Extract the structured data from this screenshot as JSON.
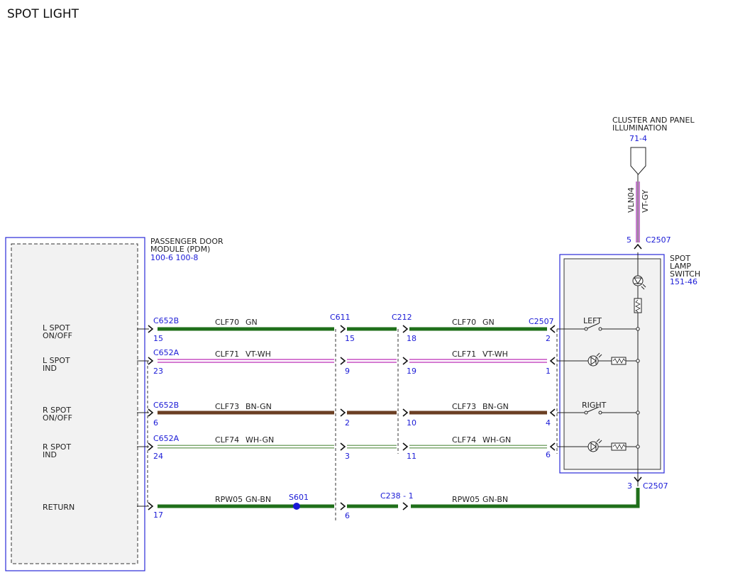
{
  "title": "SPOT LIGHT",
  "colors": {
    "ref_blue": "#1a1ad6",
    "wire_gn": "#1f6f1a",
    "wire_bn_gn": "#6b3f24",
    "wire_vt_wh": "#d57bd2",
    "wire_wh_gn": "#7faa72",
    "wire_vt_gy": "#c77ccf",
    "module_fill": "#f2f2f2"
  },
  "pdm": {
    "name_line1": "PASSENGER DOOR",
    "name_line2": "MODULE (PDM)",
    "ref": "100-6 100-8",
    "pins": [
      {
        "line1": "L SPOT",
        "line2": "ON/OFF"
      },
      {
        "line1": "L SPOT",
        "line2": "IND"
      },
      {
        "line1": "R SPOT",
        "line2": "ON/OFF"
      },
      {
        "line1": "R SPOT",
        "line2": "IND"
      },
      {
        "line1": "RETURN",
        "line2": ""
      }
    ]
  },
  "switch": {
    "name_line1": "SPOT",
    "name_line2": "LAMP",
    "name_line3": "SWITCH",
    "ref": "151-46",
    "left_label": "LEFT",
    "right_label": "RIGHT"
  },
  "illumination": {
    "line1": "CLUSTER AND PANEL",
    "line2": "ILLUMINATION",
    "ref": "71-4",
    "circuit": "VLN04",
    "color": "VT-GY",
    "pin_top": "5",
    "connector_top": "C2507",
    "pin_bottom": "3",
    "connector_bottom": "C2507"
  },
  "inline_connectors": {
    "c611": "C611",
    "c212": "C212",
    "c2507": "C2507",
    "c238": "C238 - 1",
    "splice": "S601"
  },
  "wires": [
    {
      "pdm_connector": "C652B",
      "pdm_pin": "15",
      "circuit": "CLF70",
      "color": "GN",
      "c611_pin": "15",
      "c212_pin": "18",
      "c2507_pin": "2"
    },
    {
      "pdm_connector": "C652A",
      "pdm_pin": "23",
      "circuit": "CLF71",
      "color": "VT-WH",
      "c611_pin": "9",
      "c212_pin": "19",
      "c2507_pin": "1"
    },
    {
      "pdm_connector": "C652B",
      "pdm_pin": "6",
      "circuit": "CLF73",
      "color": "BN-GN",
      "c611_pin": "2",
      "c212_pin": "10",
      "c2507_pin": "4"
    },
    {
      "pdm_connector": "C652A",
      "pdm_pin": "24",
      "circuit": "CLF74",
      "color": "WH-GN",
      "c611_pin": "3",
      "c212_pin": "11",
      "c2507_pin": "6"
    }
  ],
  "return_wire": {
    "pdm_pin": "17",
    "circuit": "RPW05",
    "color": "GN-BN",
    "c611_pin": "6"
  }
}
